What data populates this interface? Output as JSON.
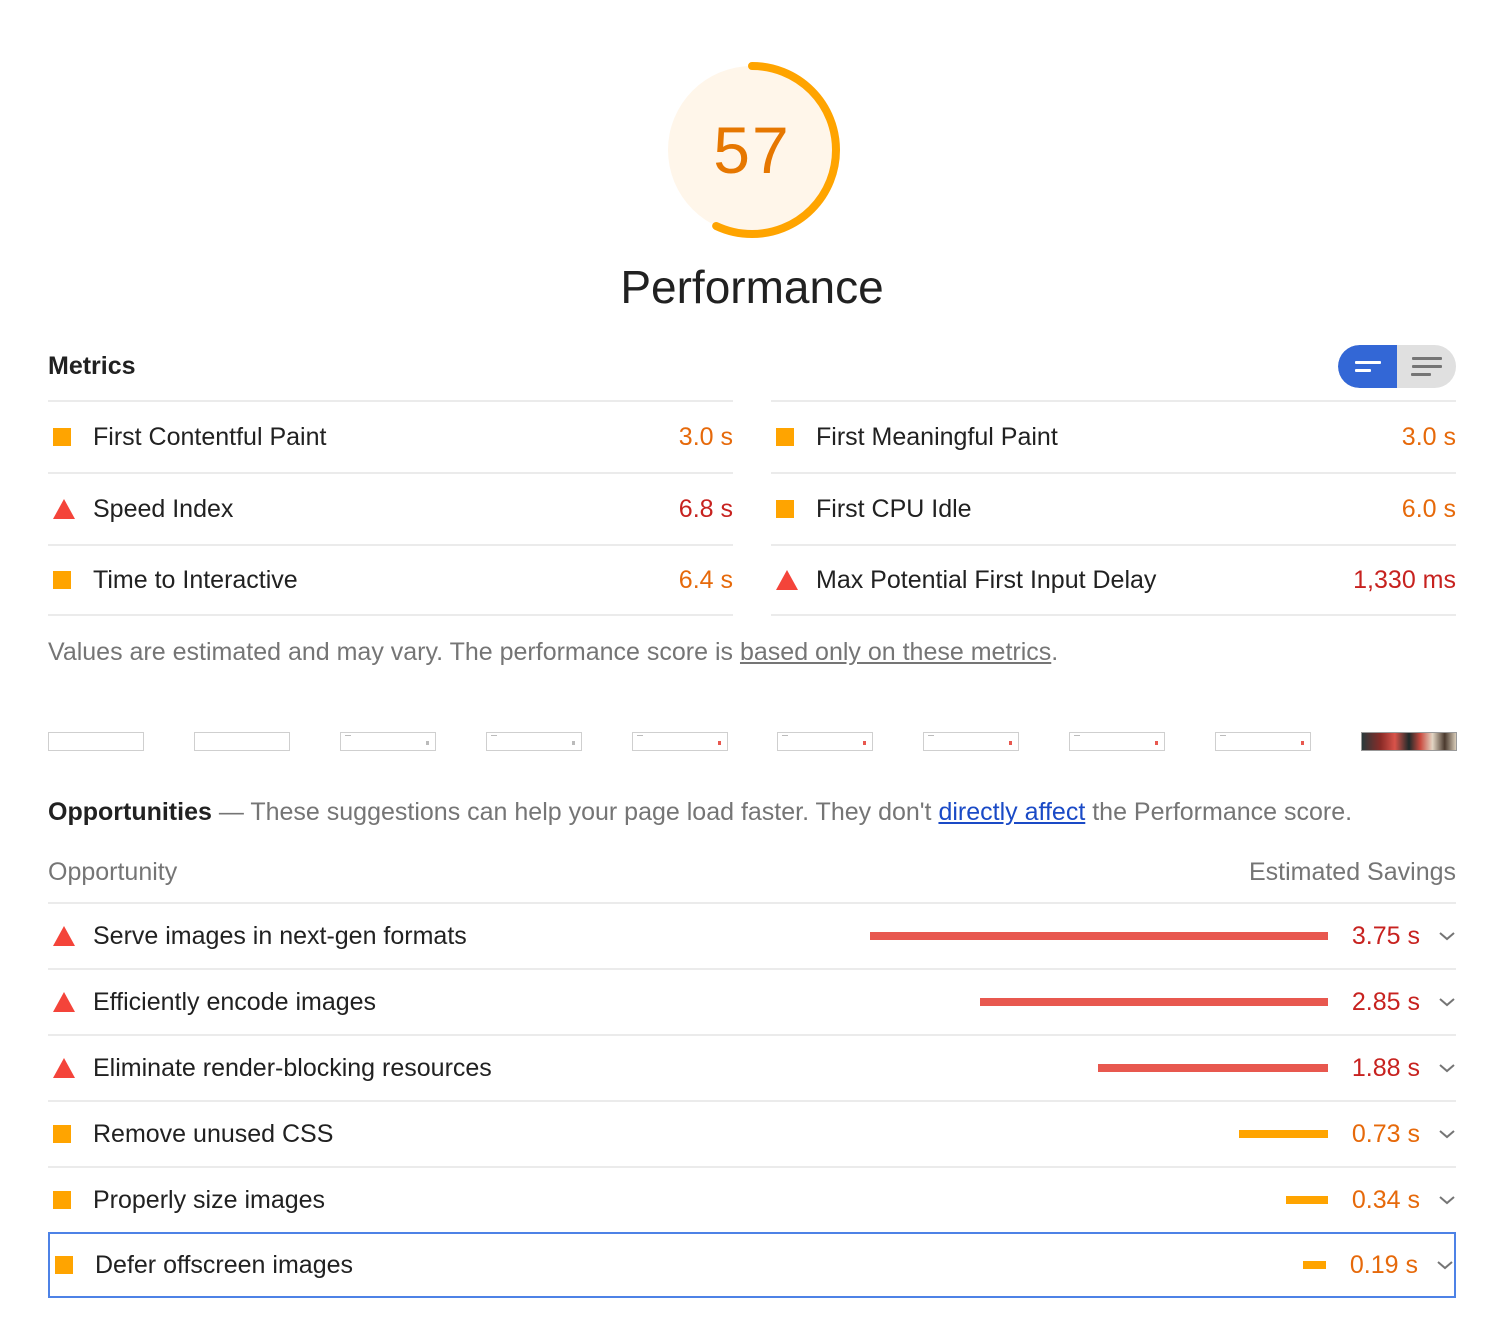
{
  "gauge": {
    "score": "57",
    "score_fraction": 0.57,
    "title": "Performance",
    "color": "#ffa400"
  },
  "metrics": {
    "title": "Metrics",
    "toggle": {
      "active": "compact-view-icon",
      "inactive": "expanded-view-icon"
    },
    "items": [
      {
        "label": "First Contentful Paint",
        "value": "3.0 s",
        "status": "average",
        "icon": "orange-square-icon"
      },
      {
        "label": "First Meaningful Paint",
        "value": "3.0 s",
        "status": "average",
        "icon": "orange-square-icon"
      },
      {
        "label": "Speed Index",
        "value": "6.8 s",
        "status": "fail",
        "icon": "red-triangle-icon"
      },
      {
        "label": "First CPU Idle",
        "value": "6.0 s",
        "status": "average",
        "icon": "orange-square-icon"
      },
      {
        "label": "Time to Interactive",
        "value": "6.4 s",
        "status": "average",
        "icon": "orange-square-icon"
      },
      {
        "label": "Max Potential First Input Delay",
        "value": "1,330 ms",
        "status": "fail",
        "icon": "red-triangle-icon"
      }
    ],
    "note_prefix": "Values are estimated and may vary. The performance score is ",
    "note_link": "based only on these metrics",
    "note_suffix": "."
  },
  "opportunities": {
    "title": "Opportunities",
    "dash": " — ",
    "desc_prefix": "These suggestions can help your page load faster. They don't ",
    "desc_link": "directly affect",
    "desc_suffix": " the Performance score.",
    "col_opportunity": "Opportunity",
    "col_savings": "Estimated Savings",
    "items": [
      {
        "label": "Serve images in next-gen formats",
        "value": "3.75 s",
        "seconds": 3.75,
        "status": "fail"
      },
      {
        "label": "Efficiently encode images",
        "value": "2.85 s",
        "seconds": 2.85,
        "status": "fail"
      },
      {
        "label": "Eliminate render-blocking resources",
        "value": "1.88 s",
        "seconds": 1.88,
        "status": "fail"
      },
      {
        "label": "Remove unused CSS",
        "value": "0.73 s",
        "seconds": 0.73,
        "status": "average"
      },
      {
        "label": "Properly size images",
        "value": "0.34 s",
        "seconds": 0.34,
        "status": "average"
      },
      {
        "label": "Defer offscreen images",
        "value": "0.19 s",
        "seconds": 0.19,
        "status": "average"
      }
    ]
  },
  "colors": {
    "fail": "#e8584f",
    "average": "#ffa400",
    "fail_text": "#c7221f",
    "average_text": "#e6690a",
    "link": "#1a4ac6",
    "toggle_active": "#3367d6"
  }
}
